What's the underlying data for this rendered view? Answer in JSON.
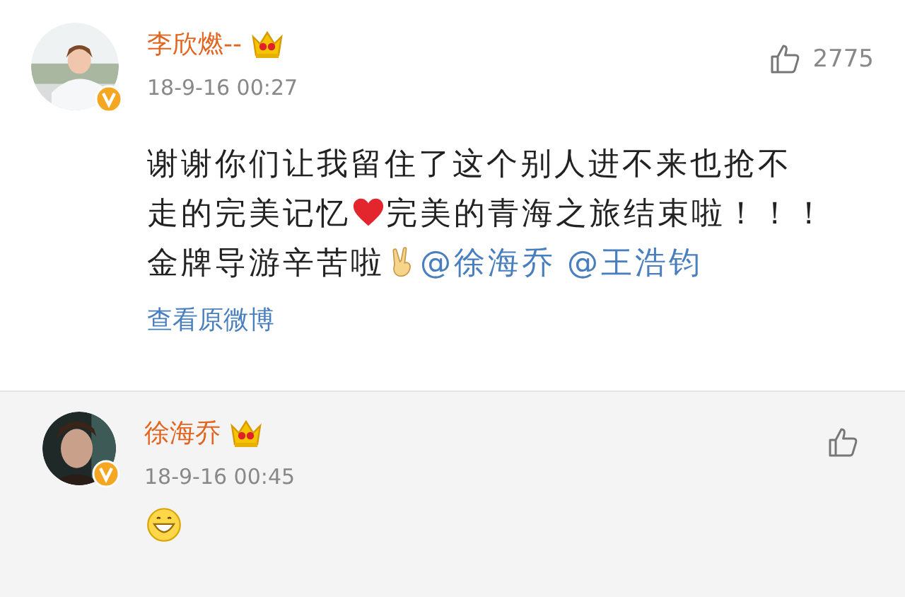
{
  "post": {
    "author": "李欣燃--",
    "time": "18-9-16 00:27",
    "likes": "2775",
    "body": [
      [
        {
          "kind": "text",
          "text": "谢谢你们让我留住了这个别人进不来也抢不"
        }
      ],
      [
        {
          "kind": "text",
          "text": "走的完美记忆"
        },
        {
          "kind": "heart"
        },
        {
          "kind": "text",
          "text": "完美的青海之旅结束啦！！！"
        }
      ],
      [
        {
          "kind": "text",
          "text": "金牌导游辛苦啦"
        },
        {
          "kind": "hand"
        },
        {
          "kind": "mention",
          "text": "@徐海乔"
        },
        {
          "kind": "mention",
          "text": "@王浩钧"
        }
      ]
    ],
    "link": "查看原微博"
  },
  "reply": {
    "author": "徐海乔",
    "time": "18-9-16 00:45",
    "body": [
      {
        "kind": "smile"
      }
    ]
  }
}
